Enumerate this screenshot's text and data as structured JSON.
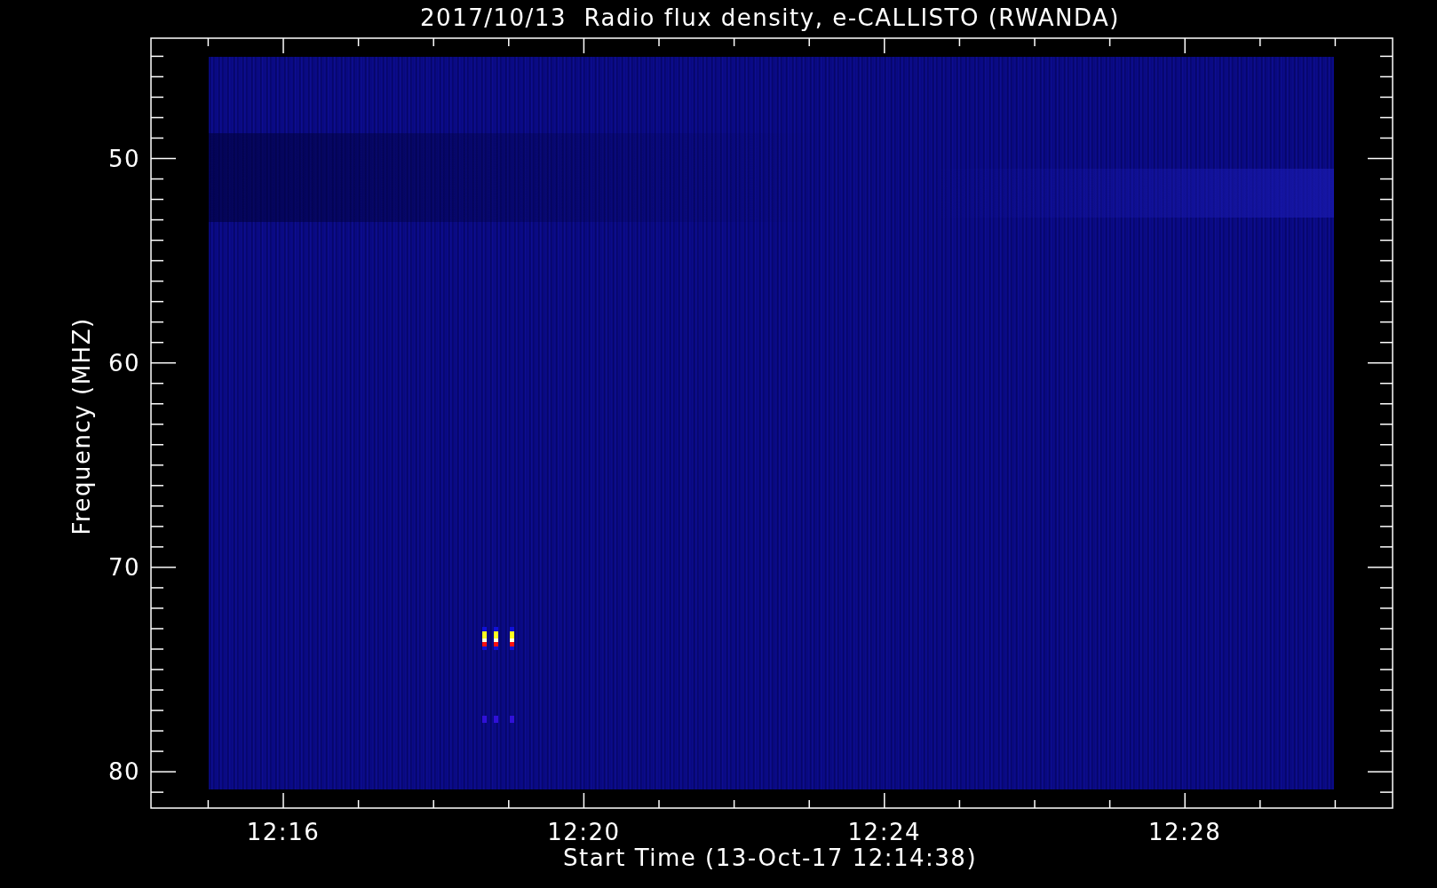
{
  "title": "2017/10/13  Radio flux density, e-CALLISTO (RWANDA)",
  "ylabel": "Frequency (MHZ)",
  "xlabel": "Start Time (13-Oct-17 12:14:38)",
  "yticks": [
    "50",
    "60",
    "70",
    "80"
  ],
  "xticks": [
    "12:16",
    "12:20",
    "12:24",
    "12:28"
  ]
}
